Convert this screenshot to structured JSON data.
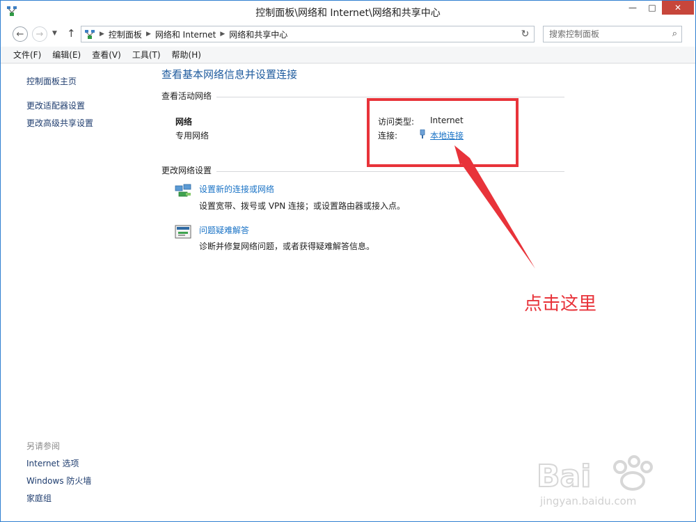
{
  "window": {
    "title": "控制面板\\网络和 Internet\\网络和共享中心",
    "minimize_glyph": "—",
    "maximize_glyph": "□",
    "close_glyph": "✕"
  },
  "nav": {
    "back_glyph": "←",
    "forward_glyph": "→",
    "recent_glyph": "▼",
    "up_glyph": "↑",
    "breadcrumbs": [
      "控制面板",
      "网络和 Internet",
      "网络和共享中心"
    ],
    "dropdown_glyph": "▼",
    "refresh_glyph": "↻",
    "search_placeholder": "搜索控制面板",
    "search_glyph": "⌕"
  },
  "menu": [
    "文件(F)",
    "编辑(E)",
    "查看(V)",
    "工具(T)",
    "帮助(H)"
  ],
  "left_pane": {
    "links": [
      "控制面板主页",
      "更改适配器设置",
      "更改高级共享设置"
    ],
    "see_also_title": "另请参阅",
    "see_also": [
      "Internet 选项",
      "Windows 防火墙",
      "家庭组"
    ]
  },
  "main": {
    "title": "查看基本网络信息并设置连接",
    "active_networks_title": "查看活动网络",
    "network": {
      "name": "网络",
      "type": "专用网络",
      "access_label": "访问类型:",
      "access_value": "Internet",
      "connection_label": "连接:",
      "connection_value": "本地连接"
    },
    "change_settings_title": "更改网络设置",
    "tasks": [
      {
        "icon": "network-setup-icon",
        "link": "设置新的连接或网络",
        "desc": "设置宽带、拨号或 VPN 连接；或设置路由器或接入点。"
      },
      {
        "icon": "troubleshoot-icon",
        "link": "问题疑难解答",
        "desc": "诊断并修复网络问题，或者获得疑难解答信息。"
      }
    ]
  },
  "annotation": {
    "text": "点击这里",
    "color": "#e8333a"
  },
  "watermark": {
    "logo": "Baidu 经验",
    "url": "jingyan.baidu.com"
  }
}
